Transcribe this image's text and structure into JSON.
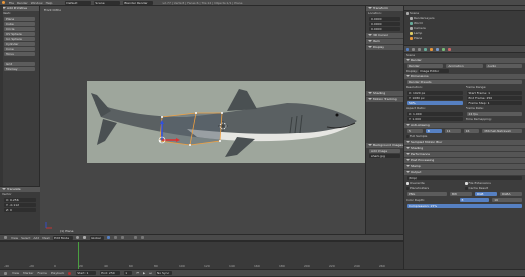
{
  "topbar": {
    "menus": [
      "File",
      "Render",
      "Window",
      "Help"
    ],
    "layout": "Default",
    "scene": "Scene",
    "engine": "Blender Render",
    "stats": "v2.77 | Verts:8 | Faces:6 | Tris:12 | Objects:1/1 | Plane"
  },
  "toolshelf": {
    "section": "Add Primitive",
    "mesh_label": "Mesh:",
    "items": [
      "Plane",
      "Cube",
      "Circle",
      "UV Sphere",
      "Ico Sphere",
      "Cylinder",
      "Cone",
      "Torus"
    ],
    "extra": [
      "Grid",
      "Monkey"
    ],
    "operator_title": "Translate",
    "vector_label": "Vector",
    "x": "X: 0.256",
    "y": "Y: -0.112",
    "z": "Z: 0"
  },
  "viewport": {
    "view_label": "Front Ortho",
    "object_label": "(1) Plane",
    "n_panel": {
      "transform": "Transform",
      "location": "Location:",
      "loc_x": "0.0000",
      "loc_y": "0.0000",
      "loc_z": "0.0000",
      "items": [
        "3D Cursor",
        "Item",
        "Display",
        "Shading",
        "Motion Tracking",
        "Background Images"
      ],
      "add_image": "Add Image",
      "image_name": "shark.jpg"
    }
  },
  "viewport_header": {
    "view": "View",
    "select": "Select",
    "add": "Add",
    "mesh": "Mesh",
    "mode": "Edit Mode",
    "pivot": "Global"
  },
  "timeline": {
    "view": "View",
    "marker": "Marker",
    "frame": "Frame",
    "playback": "Playback",
    "start": "Start: 1",
    "end": "End: 250",
    "current": "1",
    "sync": "No Sync",
    "ticks": [
      "-40",
      "-20",
      "0",
      "20",
      "40",
      "60",
      "80",
      "100",
      "120",
      "140",
      "160",
      "180",
      "200",
      "220",
      "240",
      "260"
    ]
  },
  "outliner": {
    "items": [
      "Scene",
      "RenderLayers",
      "World",
      "Camera",
      "Lamp",
      "Plane"
    ]
  },
  "properties": {
    "scene_name": "Scene",
    "render_label": "Render",
    "render_buttons": [
      "Render",
      "Animation",
      "Audio"
    ],
    "display_label": "Display:",
    "display_value": "Image Editor",
    "dimensions": "Dimensions",
    "render_presets": "Render Presets",
    "resolution": "Resolution:",
    "res_x": "X: 1920 px",
    "res_y": "Y: 1080 px",
    "res_pct": "50%",
    "frame_range": "Frame Range:",
    "start_frame": "Start Frame: 1",
    "end_frame": "End Frame: 250",
    "frame_step": "Frame Step: 1",
    "aspect": "Aspect Ratio:",
    "aspect_x": "X: 1.000",
    "aspect_y": "Y: 1.000",
    "frame_rate": "Frame Rate:",
    "fps": "24 fps",
    "time_remap": "Time Remapping:",
    "panels": [
      "Anti-Aliasing",
      "Sampled Motion Blur",
      "Shading",
      "Performance",
      "Post Processing",
      "Stamp",
      "Output"
    ],
    "aa_values": [
      "5",
      "8",
      "11",
      "16"
    ],
    "filter": "Mitchell-Netravali",
    "full_sample": "Full Sample",
    "output_path": "/tmp\\",
    "overwrite": "Overwrite",
    "file_ext": "File Extensions",
    "placeholders": "Placeholders",
    "cache": "Cache Result",
    "format": "PNG",
    "bw": "BW",
    "rgb": "RGB",
    "rgba": "RGBA",
    "color_depth": "Color Depth:",
    "depth8": "8",
    "depth16": "16",
    "compression": "Compression: 15%"
  },
  "colors": {
    "accent": "#5680c2",
    "sky": "#9aa29a",
    "orange": "#e8963a"
  }
}
